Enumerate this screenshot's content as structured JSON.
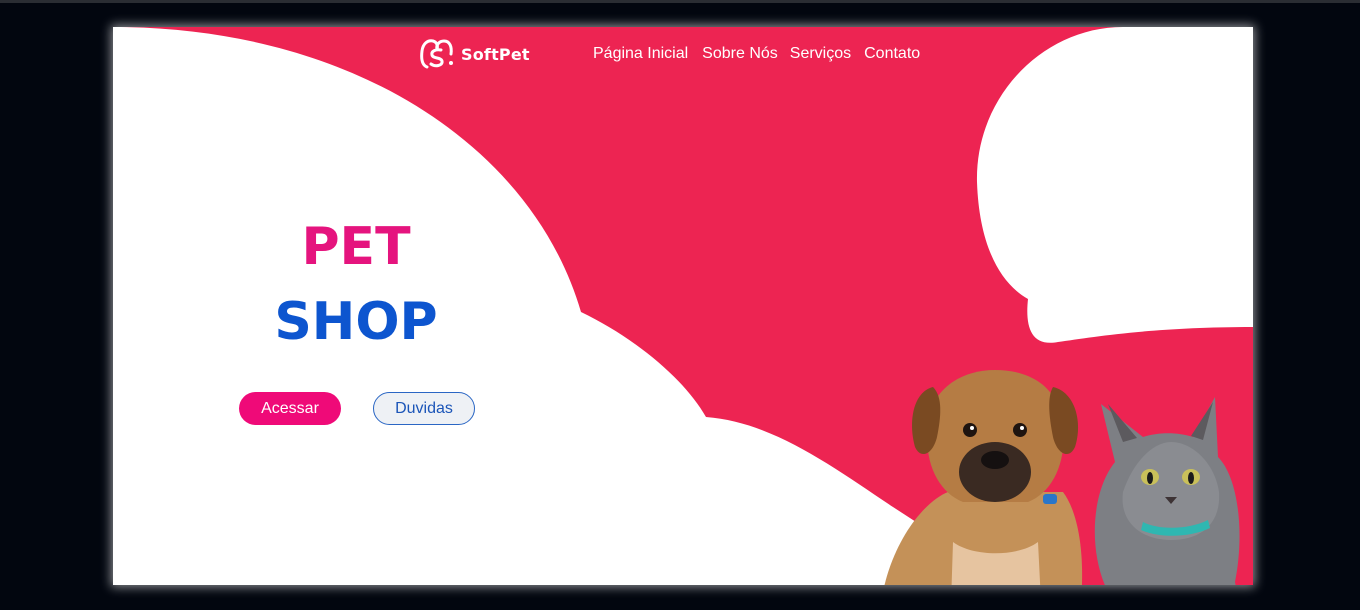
{
  "brand": {
    "name": "SoftPet",
    "primary_color": "#ed2452",
    "accent_pink": "#e5147e",
    "accent_blue": "#0d55cf"
  },
  "nav": {
    "items": [
      {
        "label": "Página Inicial"
      },
      {
        "label": "Sobre Nós"
      },
      {
        "label": "Serviços"
      },
      {
        "label": "Contato"
      }
    ]
  },
  "hero": {
    "title_line1": "PET",
    "title_line2": "SHOP",
    "primary_button": "Acessar",
    "secondary_button": "Duvidas"
  },
  "illustration": {
    "icons": [
      "softpet-logo-icon",
      "puppy-illustration",
      "cat-illustration"
    ]
  }
}
